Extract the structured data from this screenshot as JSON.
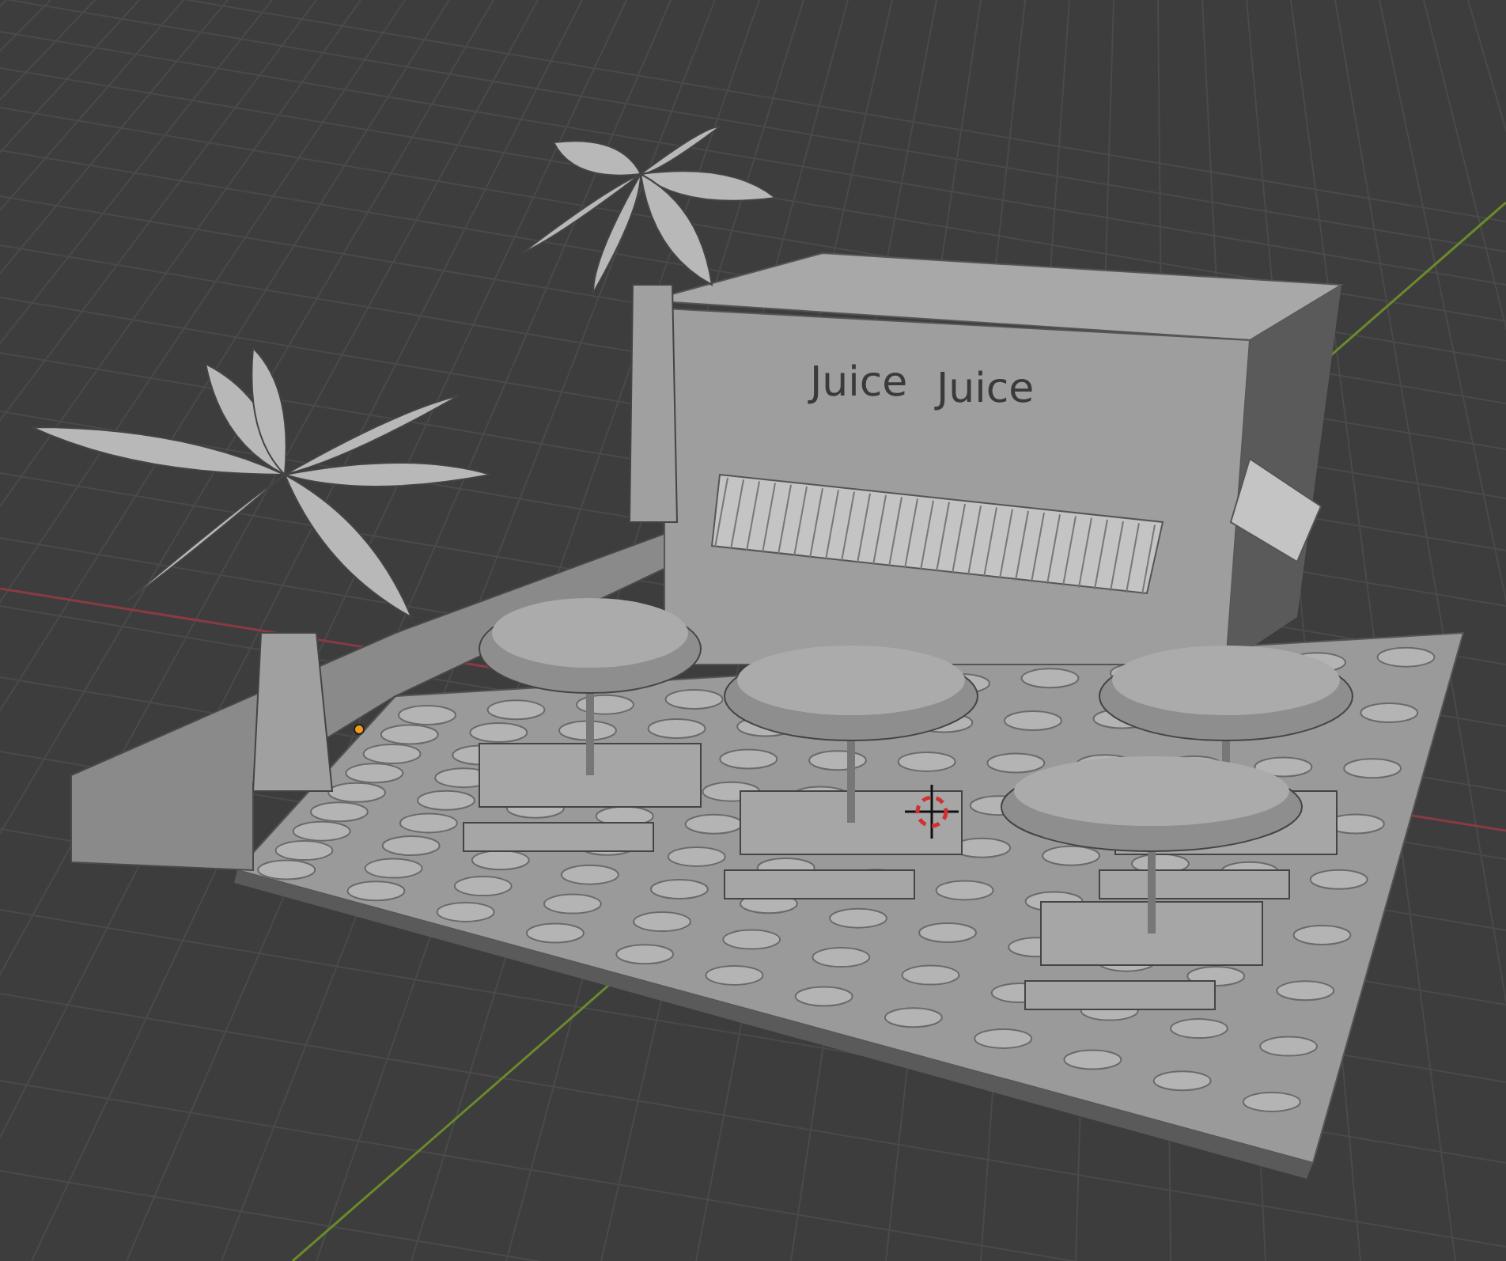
{
  "viewport": {
    "sign_words": [
      "Juice",
      "Juice"
    ]
  }
}
